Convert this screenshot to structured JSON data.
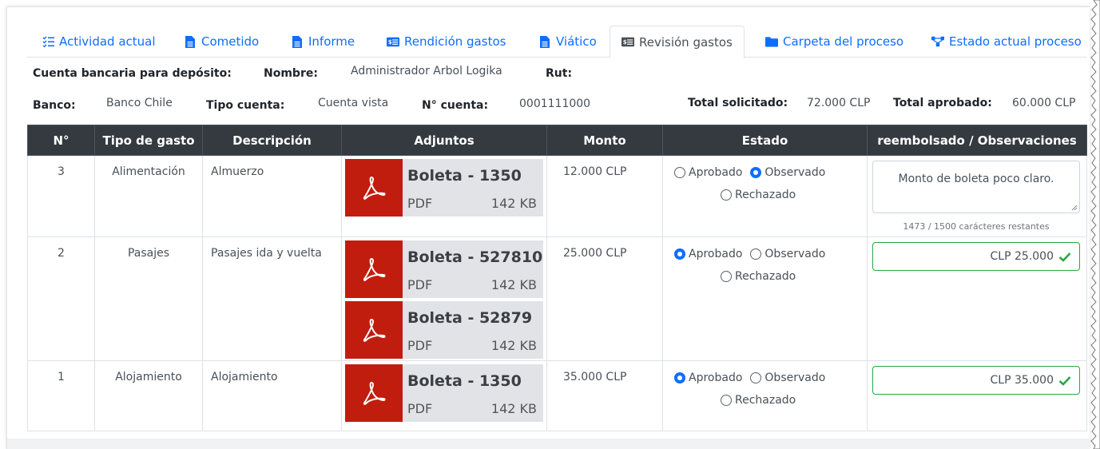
{
  "tabs": [
    {
      "label": "Actividad actual",
      "icon": "list-check-icon"
    },
    {
      "label": "Cometido",
      "icon": "file-icon"
    },
    {
      "label": "Informe",
      "icon": "file-icon"
    },
    {
      "label": "Rendición gastos",
      "icon": "money-icon"
    },
    {
      "label": "Viático",
      "icon": "file-icon"
    },
    {
      "label": "Revisión gastos",
      "icon": "money-icon",
      "active": true
    },
    {
      "label": "Carpeta del proceso",
      "icon": "folder-icon"
    },
    {
      "label": "Estado actual proceso",
      "icon": "flow-icon"
    }
  ],
  "account": {
    "title": "Cuenta bancaria para depósito:",
    "nombre_label": "Nombre:",
    "nombre": "Administrador Arbol Logika",
    "rut_label": "Rut:",
    "banco_label": "Banco:",
    "banco": "Banco Chile",
    "tipo_label": "Tipo cuenta:",
    "tipo": "Cuenta vista",
    "numero_label": "N° cuenta:",
    "numero": "0001111000"
  },
  "totals": {
    "solicitado_label": "Total solicitado:",
    "solicitado": "72.000 CLP",
    "aprobado_label": "Total aprobado:",
    "aprobado": "60.000 CLP"
  },
  "table": {
    "headers": [
      "N°",
      "Tipo de gasto",
      "Descripción",
      "Adjuntos",
      "Monto",
      "Estado",
      "reembolsado / Observaciones"
    ],
    "radio_labels": {
      "aprobado": "Aprobado",
      "observado": "Observado",
      "rechazado": "Rechazado"
    },
    "rows": [
      {
        "n": "3",
        "tipo": "Alimentación",
        "descripcion": "Almuerzo",
        "adjuntos": [
          {
            "name": "Boleta - 1350",
            "type": "PDF",
            "size": "142 KB"
          }
        ],
        "monto": "12.000 CLP",
        "estado": "observado",
        "observacion": "Monto de boleta poco claro.",
        "counter": "1473 / 1500 carácteres restantes"
      },
      {
        "n": "2",
        "tipo": "Pasajes",
        "descripcion": "Pasajes ida y vuelta",
        "adjuntos": [
          {
            "name": "Boleta - 527810",
            "type": "PDF",
            "size": "142 KB"
          },
          {
            "name": "Boleta - 52879",
            "type": "PDF",
            "size": "142 KB"
          }
        ],
        "monto": "25.000 CLP",
        "estado": "aprobado",
        "reembolsado": "CLP 25.000"
      },
      {
        "n": "1",
        "tipo": "Alojamiento",
        "descripcion": "Alojamiento",
        "adjuntos": [
          {
            "name": "Boleta - 1350",
            "type": "PDF",
            "size": "142 KB"
          }
        ],
        "monto": "35.000 CLP",
        "estado": "aprobado",
        "reembolsado": "CLP 35.000"
      }
    ]
  },
  "colors": {
    "link": "#0d6efd",
    "header_bg": "#343a40",
    "pdf_red": "#c11d0e",
    "valid_green": "#28a745"
  }
}
